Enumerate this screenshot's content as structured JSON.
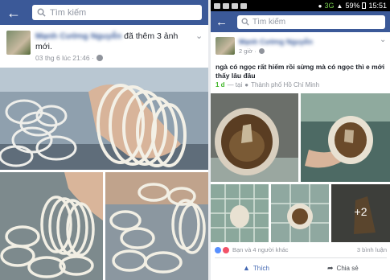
{
  "left": {
    "search_placeholder": "Tìm kiếm",
    "post": {
      "author": "Mạnh Cường Nguyễn",
      "action_text": "đã thêm 3 ảnh mới.",
      "timestamp": "03 thg 6 lúc 21:46 ·"
    }
  },
  "right": {
    "status_bar": {
      "network": "3G",
      "battery": "59%",
      "time": "15:51"
    },
    "search_placeholder": "Tìm kiếm",
    "post": {
      "author": "Mạnh Cường Nguyễn",
      "timestamp": "2 giờ ·",
      "caption": "ngà có ngọc rất hiếm rồi sừng mà có ngọc thì e mới thấy lâu đâu",
      "feeling": "1 d",
      "location_prefix": "— tại",
      "location": "Thành phố Hồ Chí Minh",
      "more_photos": "+2",
      "reactions": "Bạn và 4 người khác",
      "comments": "3 bình luận",
      "like_label": "Thích",
      "share_label": "Chia sẻ"
    }
  },
  "colors": {
    "fb_blue": "#3b5998",
    "link_blue": "#365899",
    "green": "#42b72a"
  }
}
